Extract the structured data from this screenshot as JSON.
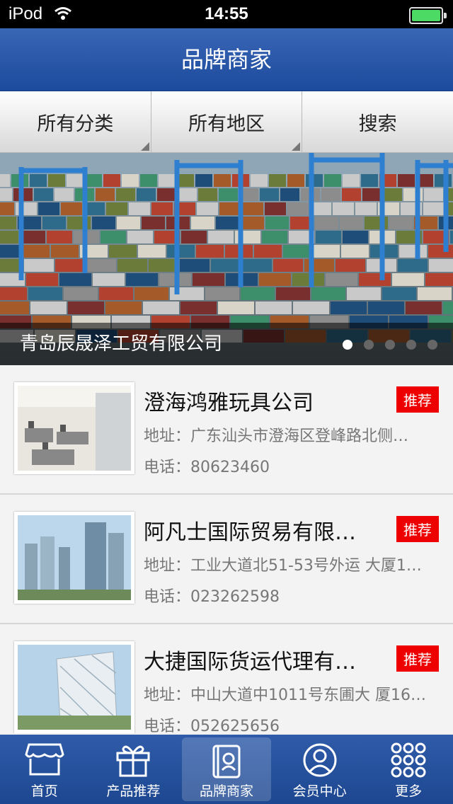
{
  "status_bar": {
    "carrier": "iPod",
    "time": "14:55"
  },
  "header": {
    "title": "品牌商家"
  },
  "filters": [
    {
      "label": "所有分类"
    },
    {
      "label": "所有地区"
    },
    {
      "label": "搜索"
    }
  ],
  "banner": {
    "caption": "青岛辰晟泽工贸有限公司",
    "page_count": 5,
    "active_index": 0
  },
  "companies": [
    {
      "name": "澄海鸿雅玩具公司",
      "badge": "推荐",
      "address": "地址：广东汕头市澄海区登峰路北侧…",
      "phone": "电话：80623460",
      "thumb": "office-photo"
    },
    {
      "name": "阿凡士国际贸易有限…",
      "badge": "推荐",
      "address": "地址：工业大道北51-53号外运 大厦1…",
      "phone": "电话：023262598",
      "thumb": "skyscraper-photo"
    },
    {
      "name": "大捷国际货运代理有…",
      "badge": "推荐",
      "address": "地址：中山大道中1011号东圃大 厦16…",
      "phone": "电话：052625656",
      "thumb": "building-photo"
    }
  ],
  "tabs": [
    {
      "label": "首页",
      "icon": "store-icon"
    },
    {
      "label": "产品推荐",
      "icon": "gift-icon"
    },
    {
      "label": "品牌商家",
      "icon": "brand-book-icon",
      "active": true
    },
    {
      "label": "会员中心",
      "icon": "user-icon"
    },
    {
      "label": "更多",
      "icon": "more-grid-icon"
    }
  ]
}
